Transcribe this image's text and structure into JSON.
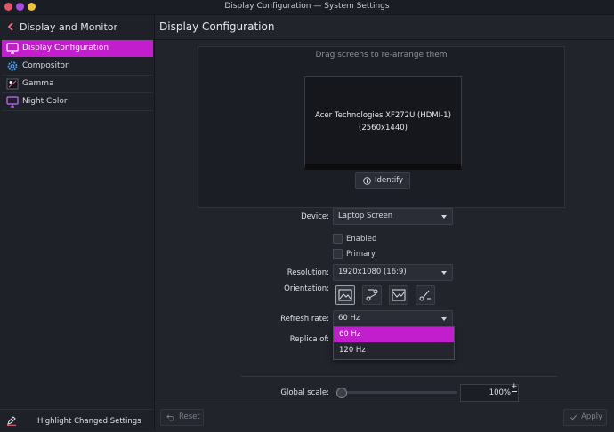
{
  "window": {
    "title": "Display Configuration — System Settings"
  },
  "sidebar": {
    "back_icon": "chevron-left-icon",
    "title": "Display and Monitor",
    "items": [
      {
        "label": "Display Configuration",
        "icon": "monitor-icon",
        "active": true
      },
      {
        "label": "Compositor",
        "icon": "gear-icon",
        "active": false
      },
      {
        "label": "Gamma",
        "icon": "gamma-icon",
        "active": false
      },
      {
        "label": "Night Color",
        "icon": "night-color-icon",
        "active": false
      }
    ],
    "footer": {
      "icon": "pencil-icon",
      "label": "Highlight Changed Settings"
    }
  },
  "main": {
    "title": "Display Configuration",
    "arrange_hint": "Drag screens to re-arrange them",
    "screen": {
      "name": "Acer Technologies XF272U (HDMI-1)",
      "resolution": "(2560x1440)"
    },
    "identify_label": "Identify",
    "device": {
      "label": "Device:",
      "value": "Laptop Screen"
    },
    "enabled_label": "Enabled",
    "primary_label": "Primary",
    "resolution": {
      "label": "Resolution:",
      "value": "1920x1080 (16:9)"
    },
    "orientation": {
      "label": "Orientation:"
    },
    "refresh": {
      "label": "Refresh rate:",
      "value": "60 Hz",
      "options": [
        "60 Hz",
        "120 Hz"
      ]
    },
    "replica": {
      "label": "Replica of:"
    },
    "scale": {
      "label": "Global scale:",
      "value": "100%"
    },
    "reset_label": "Reset",
    "apply_label": "Apply"
  },
  "colors": {
    "accent": "#c21ecd",
    "background": "#22242c",
    "sidebar": "#1f2128"
  }
}
